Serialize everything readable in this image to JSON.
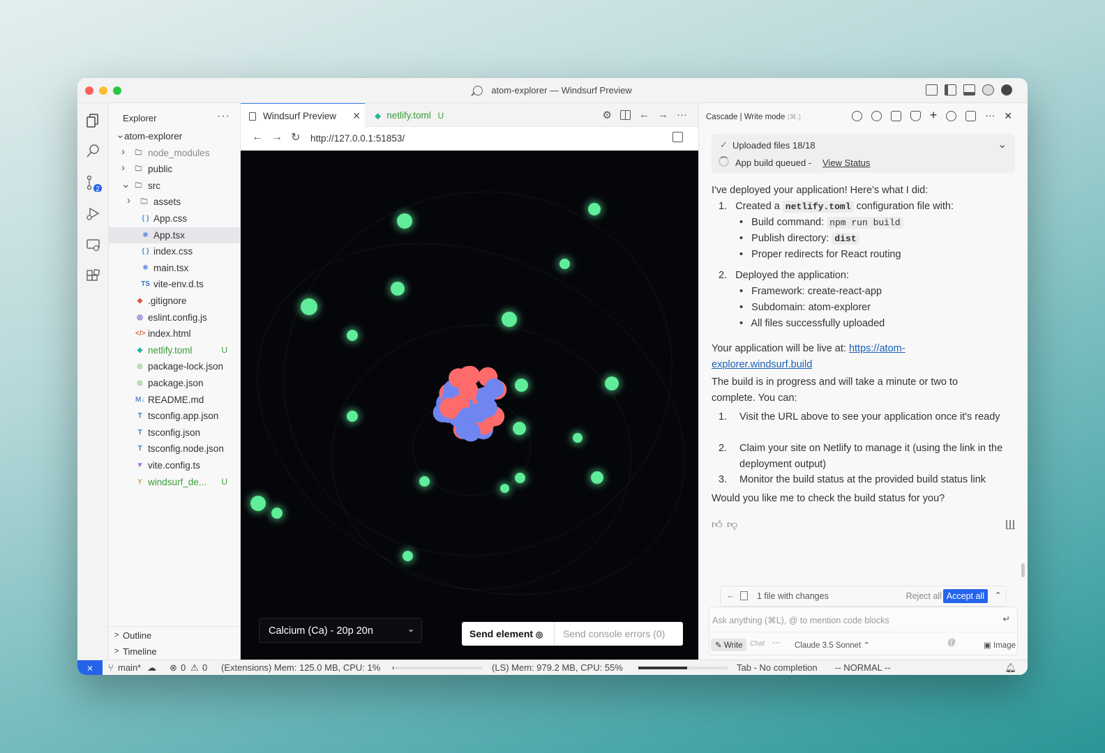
{
  "window": {
    "title": "atom-explorer — Windsurf Preview"
  },
  "explorer": {
    "header": "Explorer",
    "items": [
      {
        "label": "atom-explorer",
        "depth": 0,
        "chev": "v",
        "kind": "root"
      },
      {
        "label": "node_modules",
        "depth": 1,
        "chev": ">",
        "kind": "folder",
        "muted": true
      },
      {
        "label": "public",
        "depth": 1,
        "chev": ">",
        "kind": "folder"
      },
      {
        "label": "src",
        "depth": 1,
        "chev": "v",
        "kind": "folder"
      },
      {
        "label": "assets",
        "depth": 2,
        "chev": ">",
        "kind": "folder"
      },
      {
        "label": "App.css",
        "depth": 2,
        "kind": "css"
      },
      {
        "label": "App.tsx",
        "depth": 2,
        "kind": "react",
        "selected": true
      },
      {
        "label": "index.css",
        "depth": 2,
        "kind": "css"
      },
      {
        "label": "main.tsx",
        "depth": 2,
        "kind": "react"
      },
      {
        "label": "vite-env.d.ts",
        "depth": 2,
        "kind": "ts"
      },
      {
        "label": ".gitignore",
        "depth": 1,
        "kind": "git"
      },
      {
        "label": "eslint.config.js",
        "depth": 1,
        "kind": "eslint"
      },
      {
        "label": "index.html",
        "depth": 1,
        "kind": "html"
      },
      {
        "label": "netlify.toml",
        "depth": 1,
        "kind": "netlify",
        "badge": "U",
        "green": true
      },
      {
        "label": "package-lock.json",
        "depth": 1,
        "kind": "npm"
      },
      {
        "label": "package.json",
        "depth": 1,
        "kind": "npm"
      },
      {
        "label": "README.md",
        "depth": 1,
        "kind": "md"
      },
      {
        "label": "tsconfig.app.json",
        "depth": 1,
        "kind": "tsconfig"
      },
      {
        "label": "tsconfig.json",
        "depth": 1,
        "kind": "tsconfig"
      },
      {
        "label": "tsconfig.node.json",
        "depth": 1,
        "kind": "tsconfig"
      },
      {
        "label": "vite.config.ts",
        "depth": 1,
        "kind": "vite"
      },
      {
        "label": "windsurf_de...",
        "depth": 1,
        "kind": "yaml",
        "badge": "U",
        "green": true
      }
    ],
    "outline": "Outline",
    "timeline": "Timeline"
  },
  "activity": {
    "scm_badge": "2"
  },
  "editor": {
    "tabs": [
      {
        "label": "Windsurf Preview",
        "active": true
      },
      {
        "label": "netlify.toml",
        "badge": "U"
      }
    ],
    "url": "http://127.0.0.1:51853/"
  },
  "preview": {
    "element_select": "Calcium (Ca) - 20p 20n",
    "send_element": "Send element",
    "send_console": "Send console errors (0)"
  },
  "cascade": {
    "header": "Cascade | Write mode",
    "shortcut": "(⌘.)",
    "uploaded": "Uploaded files 18/18",
    "build_queued": "App build queued -",
    "view_status": "View Status",
    "intro": "I've deployed your application! Here's what I did:",
    "step1_a": "Created a",
    "step1_code": "netlify.toml",
    "step1_b": "configuration file with:",
    "b1_label": "Build command:",
    "b1_code": "npm run build",
    "b2_label": "Publish directory:",
    "b2_code": "dist",
    "b3": "Proper redirects for React routing",
    "step2": "Deployed the application:",
    "c1": "Framework: create-react-app",
    "c2": "Subdomain: atom-explorer",
    "c3": "All files successfully uploaded",
    "live_a": "Your application will be live at:",
    "live_link": "https://atom-explorer.windsurf.build",
    "progress": "The build is in progress and will take a minute or two to complete. You can:",
    "d1": "Visit the URL above to see your application once it's ready",
    "d2": "Claim your site on Netlify to manage it (using the link in the deployment output)",
    "d3": "Monitor the build status at the provided build status link",
    "question": "Would you like me to check the build status for you?",
    "changes": "1 file with changes",
    "reject": "Reject all",
    "accept": "Accept all",
    "input_placeholder": "Ask anything (⌘L), @ to mention code blocks",
    "mode_write": "Write",
    "mode_chat": "Chat",
    "model": "Claude 3.5 Sonnet",
    "image": "Image"
  },
  "status": {
    "branch": "main*",
    "errors": "0",
    "warnings": "0",
    "ext_mem": "(Extensions) Mem: 125.0 MB, CPU: 1%",
    "ls_mem": "(LS) Mem: 979.2 MB, CPU: 55%",
    "completion": "Tab - No completion",
    "mode": "-- NORMAL --",
    "ext_cpu": 0.01,
    "ls_cpu": 0.55
  },
  "colors": {
    "accent": "#2563eb",
    "electron": "#5fed9a",
    "proton": "#ff6b6b",
    "neutron": "#6f86f0",
    "untracked": "#3a9e3a"
  }
}
